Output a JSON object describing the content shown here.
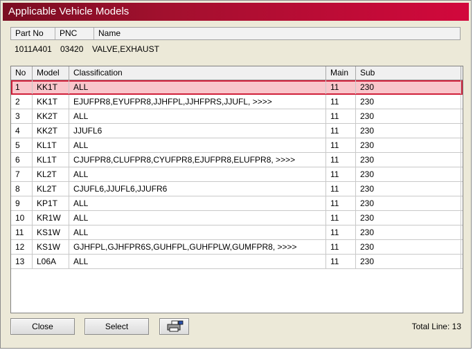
{
  "window": {
    "title": "Applicable Vehicle Models"
  },
  "info": {
    "headers": {
      "part_no": "Part No",
      "pnc": "PNC",
      "name": "Name"
    },
    "values": {
      "part_no": "1011A401",
      "pnc": "03420",
      "name": "VALVE,EXHAUST"
    }
  },
  "table": {
    "headers": {
      "no": "No",
      "model": "Model",
      "classification": "Classification",
      "main": "Main",
      "sub": "Sub"
    },
    "rows": [
      {
        "no": "1",
        "model": "KK1T",
        "classification": "ALL",
        "main": "11",
        "sub": "230"
      },
      {
        "no": "2",
        "model": "KK1T",
        "classification": "EJUFPR8,EYUFPR8,JJHFPL,JJHFPRS,JJUFL,  >>>>",
        "main": "11",
        "sub": "230"
      },
      {
        "no": "3",
        "model": "KK2T",
        "classification": "ALL",
        "main": "11",
        "sub": "230"
      },
      {
        "no": "4",
        "model": "KK2T",
        "classification": "JJUFL6",
        "main": "11",
        "sub": "230"
      },
      {
        "no": "5",
        "model": "KL1T",
        "classification": "ALL",
        "main": "11",
        "sub": "230"
      },
      {
        "no": "6",
        "model": "KL1T",
        "classification": "CJUFPR8,CLUFPR8,CYUFPR8,EJUFPR8,ELUFPR8,  >>>>",
        "main": "11",
        "sub": "230"
      },
      {
        "no": "7",
        "model": "KL2T",
        "classification": "ALL",
        "main": "11",
        "sub": "230"
      },
      {
        "no": "8",
        "model": "KL2T",
        "classification": "CJUFL6,JJUFL6,JJUFR6",
        "main": "11",
        "sub": "230"
      },
      {
        "no": "9",
        "model": "KP1T",
        "classification": "ALL",
        "main": "11",
        "sub": "230"
      },
      {
        "no": "10",
        "model": "KR1W",
        "classification": "ALL",
        "main": "11",
        "sub": "230"
      },
      {
        "no": "11",
        "model": "KS1W",
        "classification": "ALL",
        "main": "11",
        "sub": "230"
      },
      {
        "no": "12",
        "model": "KS1W",
        "classification": "GJHFPL,GJHFPR6S,GUHFPL,GUHFPLW,GUMFPR8,  >>>>",
        "main": "11",
        "sub": "230"
      },
      {
        "no": "13",
        "model": "L06A",
        "classification": "ALL",
        "main": "11",
        "sub": "230"
      }
    ],
    "selected_row": "1"
  },
  "footer": {
    "close_label": "Close",
    "select_label": "Select",
    "print_icon": "printer-icon",
    "total_label": "Total Line: 13"
  },
  "colors": {
    "title_gradient_start": "#7a0d22",
    "title_gradient_end": "#d2083c",
    "selection_fill": "#f9c6cb",
    "selection_border": "#d0203a"
  }
}
